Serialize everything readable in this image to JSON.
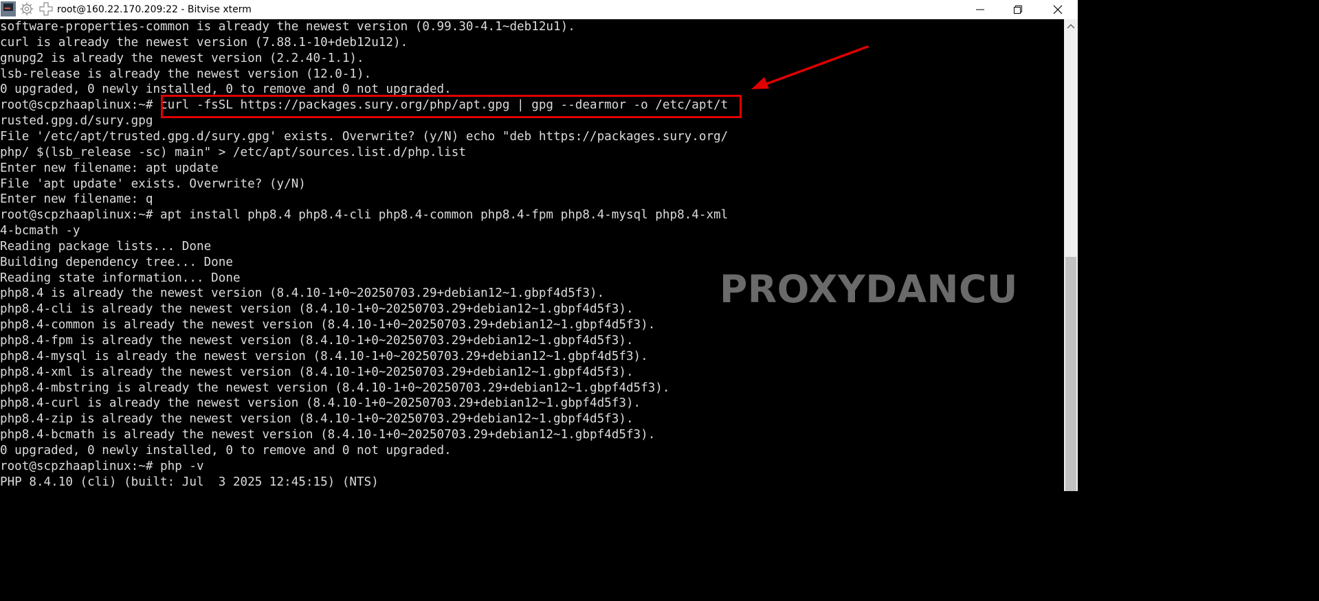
{
  "window": {
    "title": "root@160.22.170.209:22 - Bitvise xterm"
  },
  "titlebar_icons": [
    "app-icon",
    "gear-icon",
    "plus-icon"
  ],
  "window_controls": [
    "minimize-icon",
    "maximize-icon",
    "close-icon"
  ],
  "terminal": {
    "lines": [
      "software-properties-common is already the newest version (0.99.30-4.1~deb12u1).",
      "curl is already the newest version (7.88.1-10+deb12u12).",
      "gnupg2 is already the newest version (2.2.40-1.1).",
      "lsb-release is already the newest version (12.0-1).",
      "0 upgraded, 0 newly installed, 0 to remove and 0 not upgraded.",
      "root@scpzhaaplinux:~# curl -fsSL https://packages.sury.org/php/apt.gpg | gpg --dearmor -o /etc/apt/t",
      "rusted.gpg.d/sury.gpg",
      "File '/etc/apt/trusted.gpg.d/sury.gpg' exists. Overwrite? (y/N) echo \"deb https://packages.sury.org/",
      "php/ $(lsb_release -sc) main\" > /etc/apt/sources.list.d/php.list",
      "Enter new filename: apt update",
      "File 'apt update' exists. Overwrite? (y/N)",
      "Enter new filename: q",
      "root@scpzhaaplinux:~# apt install php8.4 php8.4-cli php8.4-common php8.4-fpm php8.4-mysql php8.4-xml",
      "4-bcmath -y",
      "Reading package lists... Done",
      "Building dependency tree... Done",
      "Reading state information... Done",
      "php8.4 is already the newest version (8.4.10-1+0~20250703.29+debian12~1.gbpf4d5f3).",
      "php8.4-cli is already the newest version (8.4.10-1+0~20250703.29+debian12~1.gbpf4d5f3).",
      "php8.4-common is already the newest version (8.4.10-1+0~20250703.29+debian12~1.gbpf4d5f3).",
      "php8.4-fpm is already the newest version (8.4.10-1+0~20250703.29+debian12~1.gbpf4d5f3).",
      "php8.4-mysql is already the newest version (8.4.10-1+0~20250703.29+debian12~1.gbpf4d5f3).",
      "php8.4-xml is already the newest version (8.4.10-1+0~20250703.29+debian12~1.gbpf4d5f3).",
      "php8.4-mbstring is already the newest version (8.4.10-1+0~20250703.29+debian12~1.gbpf4d5f3).",
      "php8.4-curl is already the newest version (8.4.10-1+0~20250703.29+debian12~1.gbpf4d5f3).",
      "php8.4-zip is already the newest version (8.4.10-1+0~20250703.29+debian12~1.gbpf4d5f3).",
      "php8.4-bcmath is already the newest version (8.4.10-1+0~20250703.29+debian12~1.gbpf4d5f3).",
      "0 upgraded, 0 newly installed, 0 to remove and 0 not upgraded.",
      "root@scpzhaaplinux:~# php -v",
      "PHP 8.4.10 (cli) (built: Jul  3 2025 12:45:15) (NTS)"
    ]
  },
  "annotation": {
    "highlighted_text": "curl -fsSL https://packages.sury.org/php/apt.gpg | gpg --dearmor -o /etc/apt/t",
    "color": "#e00000"
  },
  "watermark": {
    "text": "PROXYDANCU"
  },
  "colors": {
    "terminal_background": "#000000",
    "terminal_text": "#dcdcdc",
    "annotation": "#e00000"
  }
}
